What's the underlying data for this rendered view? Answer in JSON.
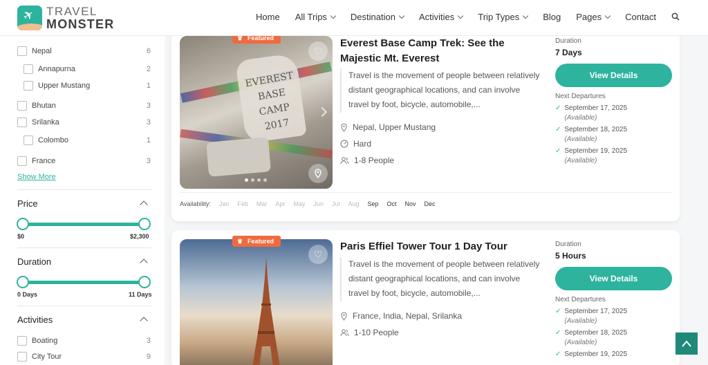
{
  "brand": {
    "line1": "TRAVEL",
    "line2": "MONSTER"
  },
  "nav": [
    "Home",
    "All Trips",
    "Destination",
    "Activities",
    "Trip Types",
    "Blog",
    "Pages",
    "Contact"
  ],
  "destinations": [
    {
      "label": "Nepal",
      "count": "6"
    },
    {
      "label": "Annapurna",
      "count": "2"
    },
    {
      "label": "Upper Mustang",
      "count": "1"
    },
    {
      "label": "Bhutan",
      "count": "3"
    },
    {
      "label": "Srilanka",
      "count": "3"
    },
    {
      "label": "Colombo",
      "count": "1"
    },
    {
      "label": "France",
      "count": "3"
    }
  ],
  "show_more": "Show More",
  "price": {
    "title": "Price",
    "min": "$0",
    "max": "$2,300"
  },
  "duration": {
    "title": "Duration",
    "min": "0 Days",
    "max": "11 Days"
  },
  "activities": {
    "title": "Activities",
    "items": [
      {
        "label": "Boating",
        "count": "3"
      },
      {
        "label": "City Tour",
        "count": "9"
      }
    ]
  },
  "trips": [
    {
      "badge": "Featured",
      "title": "Everest Base Camp Trek: See the Majestic Mt. Everest",
      "description": "Travel is the movement of people between relatively distant geographical locations, and can involve travel by foot, bicycle, automobile,...",
      "location": "Nepal, Upper Mustang",
      "difficulty": "Hard",
      "people": "1-8 People",
      "rock_text": "EVEREST BASE CAMP 2017",
      "duration_label": "Duration",
      "duration": "7 Days",
      "button": "View Details",
      "next_label": "Next Departures",
      "departures": [
        {
          "date": "September 17, 2025",
          "status": "(Available)"
        },
        {
          "date": "September 18, 2025",
          "status": "(Available)"
        },
        {
          "date": "September 19, 2025",
          "status": "(Available)"
        }
      ],
      "availability_label": "Availability:",
      "months": [
        "Jan",
        "Feb",
        "Mar",
        "Apr",
        "May",
        "Jun",
        "Jul",
        "Aug",
        "Sep",
        "Oct",
        "Nov",
        "Dec"
      ]
    },
    {
      "badge": "Featured",
      "title": "Paris Effiel Tower Tour 1 Day Tour",
      "description": "Travel is the movement of people between relatively distant geographical locations, and can involve travel by foot, bicycle, automobile,...",
      "location": "France, India, Nepal, Srilanka",
      "people": "1-10 People",
      "duration_label": "Duration",
      "duration": "5 Hours",
      "button": "View Details",
      "next_label": "Next Departures",
      "departures": [
        {
          "date": "September 17, 2025",
          "status": "(Available)"
        },
        {
          "date": "September 18, 2025",
          "status": "(Available)"
        },
        {
          "date": "September 19, 2025",
          "status": ""
        }
      ]
    }
  ],
  "colors": {
    "accent": "#2db39e",
    "badge": "#f06a3e"
  }
}
